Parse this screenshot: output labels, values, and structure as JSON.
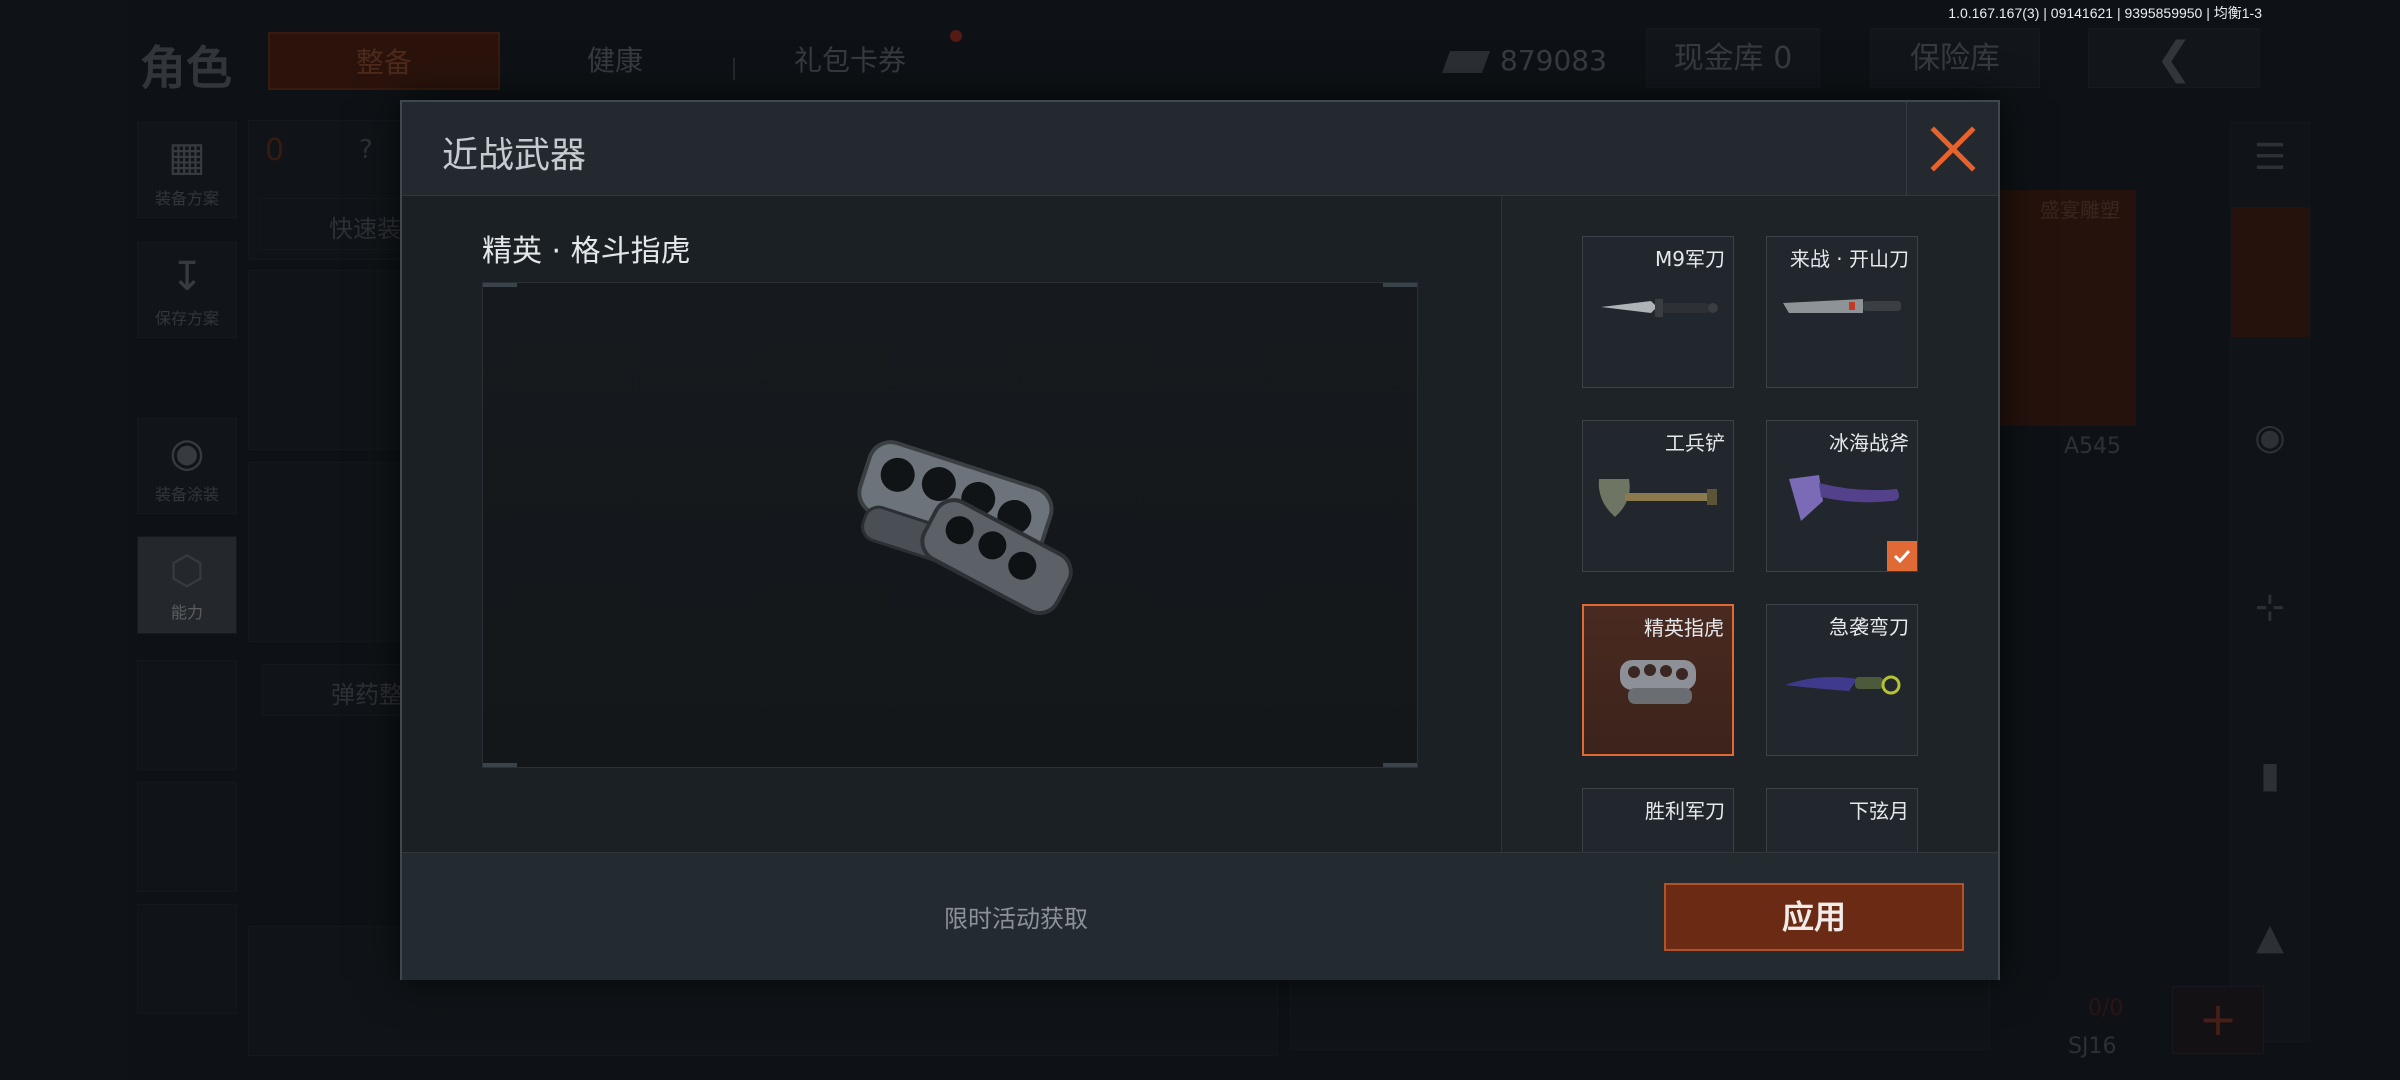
{
  "version_text": "1.0.167.167(3) | 09141621 | 9395859950 | 均衡1-3",
  "header": {
    "title": "角色",
    "tabs": [
      {
        "label": "整备",
        "active": true
      },
      {
        "label": "健康",
        "active": false
      },
      {
        "label": "礼包卡券",
        "active": false
      }
    ],
    "currency": "879083",
    "cash_vault": "现金库 0",
    "safe": "保险库",
    "back_icon": "chevron-left-icon"
  },
  "sidebar": [
    {
      "label": "装备方案",
      "icon": "vest-icon"
    },
    {
      "label": "保存方案",
      "icon": "download-icon"
    },
    {
      "label": "装备涂装",
      "icon": "helmet-icon"
    },
    {
      "label": "能力",
      "icon": "lightning-hex-icon"
    }
  ],
  "background": {
    "quick_equip": "快速装",
    "ammo": "弹药整",
    "count_zero": "0",
    "question": "?",
    "skin_name": "盛宴雕塑",
    "weapon_a": "A545",
    "weapon_b": "SJ16",
    "ammo_count": "0/0",
    "plus": "+"
  },
  "modal": {
    "title": "近战武器",
    "close_icon": "close-x-icon",
    "selected_item_title": "精英 · 格斗指虎",
    "footer_note": "限时活动获取",
    "apply_label": "应用",
    "accent_color": "#e06a36",
    "items": [
      {
        "label": "M9军刀",
        "icon": "combat-knife-icon",
        "selected": false,
        "equipped": false
      },
      {
        "label": "来战 · 开山刀",
        "icon": "machete-icon",
        "selected": false,
        "equipped": false
      },
      {
        "label": "工兵铲",
        "icon": "shovel-icon",
        "selected": false,
        "equipped": false
      },
      {
        "label": "冰海战斧",
        "icon": "axe-icon",
        "selected": false,
        "equipped": true
      },
      {
        "label": "精英指虎",
        "icon": "knuckles-icon",
        "selected": true,
        "equipped": false
      },
      {
        "label": "急袭弯刀",
        "icon": "karambit-icon",
        "selected": false,
        "equipped": false
      },
      {
        "label": "胜利军刀",
        "icon": "knife-icon",
        "selected": false,
        "equipped": false
      },
      {
        "label": "下弦月",
        "icon": "crescent-blade-icon",
        "selected": false,
        "equipped": false
      }
    ]
  }
}
